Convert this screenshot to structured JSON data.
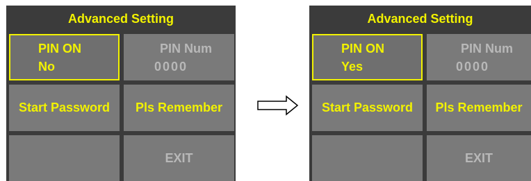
{
  "screens": [
    {
      "title": "Advanced Setting",
      "pin_on": {
        "label": "PIN ON",
        "value": "No"
      },
      "pin_num": {
        "label": "PIN Num",
        "value": "0000"
      },
      "start_password": "Start Password",
      "pls_remember": "Pls Remember",
      "exit": "EXIT"
    },
    {
      "title": "Advanced Setting",
      "pin_on": {
        "label": "PIN ON",
        "value": "Yes"
      },
      "pin_num": {
        "label": "PIN Num",
        "value": "0000"
      },
      "start_password": "Start Password",
      "pls_remember": "Pls Remember",
      "exit": "EXIT"
    }
  ],
  "colors": {
    "panel_bg": "#3b3b3b",
    "button_bg": "#7a7a7a",
    "accent_yellow": "#f2f200",
    "disabled_text": "#b8b8b8"
  },
  "transition_icon": "right-arrow-icon"
}
